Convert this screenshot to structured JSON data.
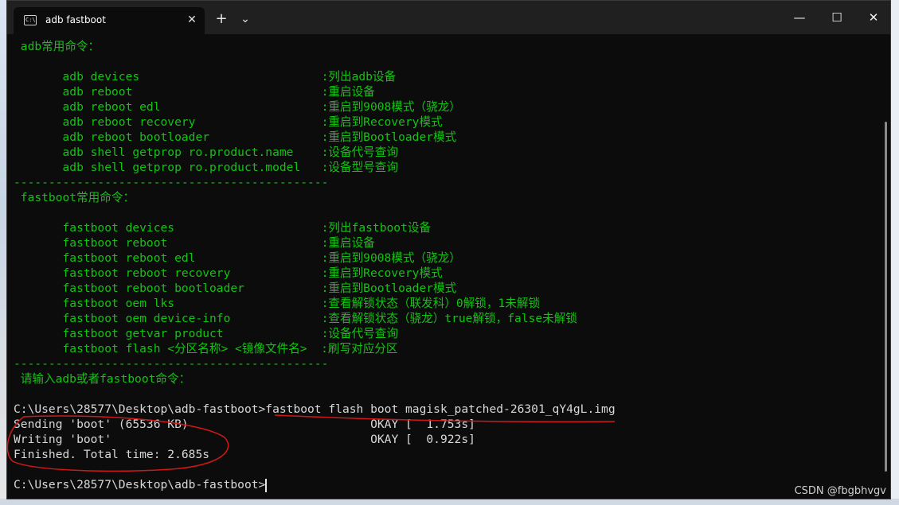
{
  "window": {
    "tab_title": "adb fastboot",
    "new_tab": "+",
    "dropdown": "⌄",
    "minimize": "—",
    "maximize": "☐",
    "close": "✕",
    "tab_close": "✕"
  },
  "terminal": {
    "lines": [
      " adb常用命令：",
      "",
      "       adb devices                          :列出adb设备",
      "       adb reboot                           :重启设备",
      "       adb reboot edl                       :重启到9008模式（骁龙）",
      "       adb reboot recovery                  :重启到Recovery模式",
      "       adb reboot bootloader                :重启到Bootloader模式",
      "       adb shell getprop ro.product.name    :设备代号查询",
      "       adb shell getprop ro.product.model   :设备型号查询",
      "---------------------------------------------",
      " fastboot常用命令：",
      "",
      "       fastboot devices                     :列出fastboot设备",
      "       fastboot reboot                      :重启设备",
      "       fastboot reboot edl                  :重启到9008模式（骁龙）",
      "       fastboot reboot recovery             :重启到Recovery模式",
      "       fastboot reboot bootloader           :重启到Bootloader模式",
      "       fastboot oem lks                     :查看解锁状态（联发科）0解锁，1未解锁",
      "       fastboot oem device-info             :查看解锁状态（骁龙）true解锁，false未解锁",
      "       fastboot getvar product              :设备代号查询",
      "       fastboot flash <分区名称> <镜像文件名>  :刷写对应分区",
      "---------------------------------------------",
      " 请输入adb或者fastboot命令：",
      ""
    ],
    "output": [
      "C:\\Users\\28577\\Desktop\\adb-fastboot>fastboot flash boot magisk_patched-26301_qY4gL.img",
      "Sending 'boot' (65536 KB)                          OKAY [  1.753s]",
      "Writing 'boot'                                     OKAY [  0.922s]",
      "Finished. Total time: 2.685s",
      "",
      "C:\\Users\\28577\\Desktop\\adb-fastboot>"
    ]
  },
  "watermark": "CSDN @fbgbhvgv",
  "colors": {
    "terminal_text": "#13c313",
    "output_text": "#d8d8d8",
    "annotation": "#d01818"
  }
}
